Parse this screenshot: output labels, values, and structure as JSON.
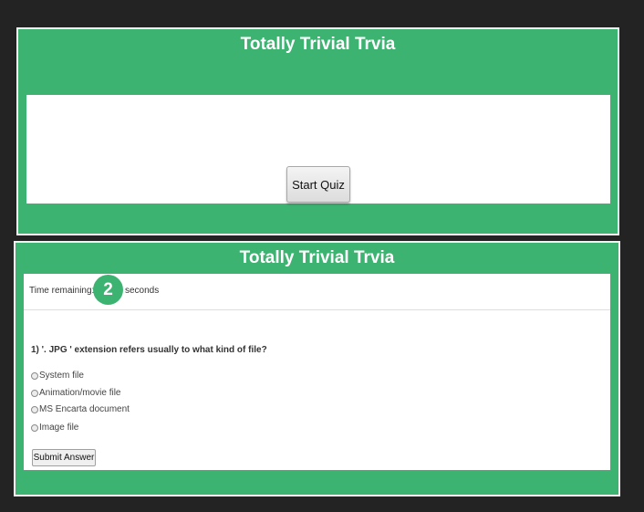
{
  "top_panel": {
    "title": "Totally Trivial Trvia",
    "start_button_label": "Start Quiz"
  },
  "bottom_panel": {
    "title": "Totally Trivial Trvia",
    "timer": {
      "label": "Time remaining:",
      "value": "2",
      "unit": "seconds"
    },
    "question": "1) '. JPG ' extension refers usually to what kind of file?",
    "options": [
      "System file",
      "Animation/movie file",
      "MS Encarta document",
      "Image file"
    ],
    "submit_label": "Submit Answer"
  },
  "colors": {
    "accent_green": "#3db372",
    "background": "#232323"
  }
}
